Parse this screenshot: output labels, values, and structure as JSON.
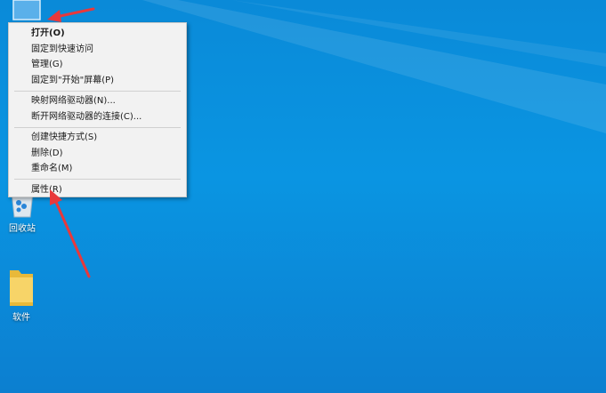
{
  "desktop": {
    "icons": [
      {
        "label": "回收站",
        "icon": "recycle-bin-icon"
      },
      {
        "label": "软件",
        "icon": "folder-icon"
      }
    ]
  },
  "context_menu": {
    "groups": [
      [
        "打开(O)",
        "固定到快速访问",
        "管理(G)",
        "固定到\"开始\"屏幕(P)"
      ],
      [
        "映射网络驱动器(N)...",
        "断开网络驱动器的连接(C)..."
      ],
      [
        "创建快捷方式(S)",
        "删除(D)",
        "重命名(M)"
      ],
      [
        "属性(R)"
      ]
    ]
  },
  "colors": {
    "desktop_bg": "#0a8ad8",
    "menu_bg": "#f2f2f2",
    "annotation_arrow": "#e8383b"
  }
}
